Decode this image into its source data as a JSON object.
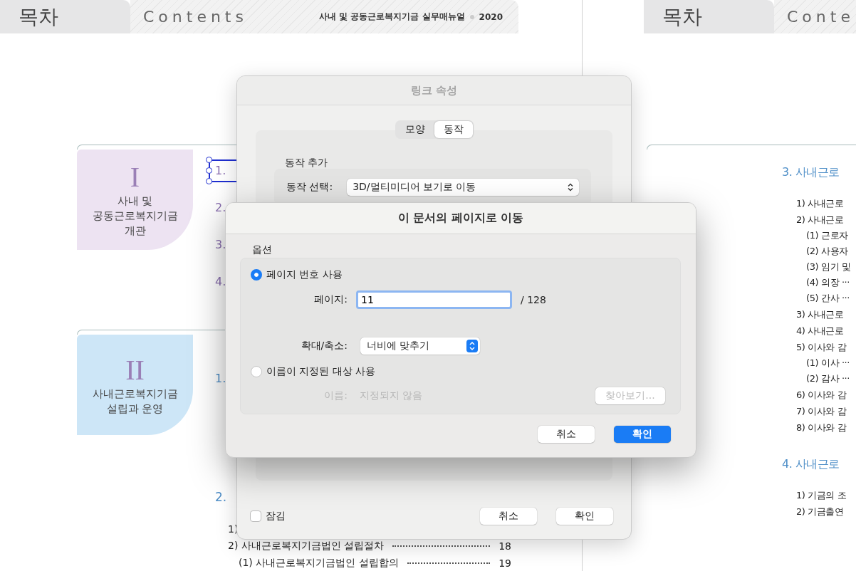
{
  "left_page": {
    "header": {
      "title": "목차",
      "subtitle": "Contents",
      "manual": "사내 및 공동근로복지기금 실무매뉴얼",
      "year": "2020"
    },
    "sections": [
      {
        "numeral": "I",
        "title": "사내 및\n공동근로복지기금\n개관",
        "color": "#ede3f2",
        "items": [
          {
            "text": "1.",
            "selected": true
          },
          {
            "text": "2.",
            "selected": false
          },
          {
            "text": "3.",
            "selected": false
          },
          {
            "text": "4.",
            "selected": false
          }
        ]
      },
      {
        "numeral": "II",
        "title": "사내근로복지기금\n설립과 운영",
        "color": "#cde6f7",
        "items": [
          {
            "text": "1.",
            "selected": false
          }
        ]
      }
    ],
    "subsection": {
      "heading": "2.",
      "entries": [
        {
          "text": "1)"
        },
        {
          "text": "2) 사내근로복지기금법인 설립절차",
          "page": "18",
          "children": [
            {
              "text": "(1) 사내근로복지기금법인 설립합의",
              "page": "19"
            }
          ]
        }
      ]
    }
  },
  "right_page": {
    "header": {
      "title": "목차",
      "subtitle": "Conte"
    },
    "sections": [
      {
        "heading": "3. 사내근로",
        "entries": [
          {
            "text": "1) 사내근로"
          },
          {
            "text": "2) 사내근로",
            "children": [
              {
                "text": "(1) 근로자"
              },
              {
                "text": "(2) 사용자"
              },
              {
                "text": "(3) 임기 및"
              },
              {
                "text": "(4) 의장 ···"
              },
              {
                "text": "(5) 간사 ···"
              }
            ]
          },
          {
            "text": "3) 사내근로"
          },
          {
            "text": "4) 사내근로"
          },
          {
            "text": "5) 이사와 감",
            "children": [
              {
                "text": "(1) 이사 ···"
              },
              {
                "text": "(2) 감사 ···"
              }
            ]
          },
          {
            "text": "6) 이사와 감"
          },
          {
            "text": "7) 이사와 감"
          },
          {
            "text": "8) 이사와 감"
          }
        ]
      },
      {
        "heading": "4. 사내근로",
        "entries": [
          {
            "text": "1) 기금의 조"
          },
          {
            "text": "2) 기금출연"
          }
        ]
      }
    ]
  },
  "link_dialog": {
    "title": "링크 속성",
    "tabs": [
      {
        "label": "모양",
        "selected": false
      },
      {
        "label": "동작",
        "selected": true
      }
    ],
    "section_label": "동작 추가",
    "action_label": "동작 선택:",
    "action_value": "3D/멀티미디어 보기로 이동",
    "lock": {
      "label": "잠김",
      "checked": false
    },
    "buttons": [
      {
        "label": "취소",
        "kind": "default"
      },
      {
        "label": "확인",
        "kind": "default"
      }
    ]
  },
  "goto_dialog": {
    "title": "이 문서의 페이지로 이동",
    "group_label": "옵션",
    "options": [
      {
        "label": "페이지 번호 사용",
        "selected": true
      },
      {
        "label": "이름이 지정된 대상 사용",
        "selected": false
      }
    ],
    "page_label": "페이지:",
    "page_value": "11",
    "page_total": "/ 128",
    "zoom_label": "확대/축소:",
    "zoom_value": "너비에 맞추기",
    "name_label": "이름:",
    "name_value": "지정되지 않음",
    "name_disabled": true,
    "browse": {
      "label": "찾아보기...",
      "disabled": true
    },
    "buttons": [
      {
        "label": "취소",
        "kind": "default"
      },
      {
        "label": "확인",
        "kind": "primary"
      }
    ]
  }
}
